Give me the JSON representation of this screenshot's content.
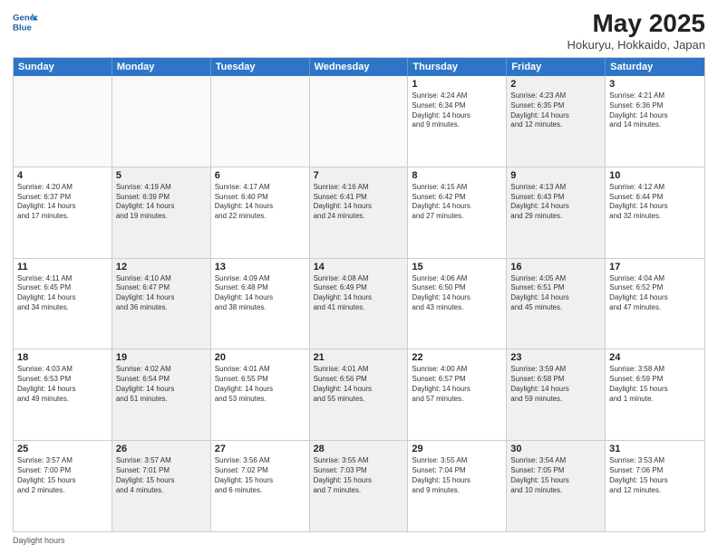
{
  "header": {
    "logo_line1": "General",
    "logo_line2": "Blue",
    "title": "May 2025",
    "subtitle": "Hokuryu, Hokkaido, Japan"
  },
  "days_of_week": [
    "Sunday",
    "Monday",
    "Tuesday",
    "Wednesday",
    "Thursday",
    "Friday",
    "Saturday"
  ],
  "weeks": [
    [
      {
        "day": "",
        "text": "",
        "shaded": true,
        "empty": true
      },
      {
        "day": "",
        "text": "",
        "shaded": true,
        "empty": true
      },
      {
        "day": "",
        "text": "",
        "shaded": true,
        "empty": true
      },
      {
        "day": "",
        "text": "",
        "shaded": true,
        "empty": true
      },
      {
        "day": "1",
        "text": "Sunrise: 4:24 AM\nSunset: 6:34 PM\nDaylight: 14 hours\nand 9 minutes.",
        "shaded": false
      },
      {
        "day": "2",
        "text": "Sunrise: 4:23 AM\nSunset: 6:35 PM\nDaylight: 14 hours\nand 12 minutes.",
        "shaded": true
      },
      {
        "day": "3",
        "text": "Sunrise: 4:21 AM\nSunset: 6:36 PM\nDaylight: 14 hours\nand 14 minutes.",
        "shaded": false
      }
    ],
    [
      {
        "day": "4",
        "text": "Sunrise: 4:20 AM\nSunset: 6:37 PM\nDaylight: 14 hours\nand 17 minutes.",
        "shaded": false
      },
      {
        "day": "5",
        "text": "Sunrise: 4:19 AM\nSunset: 6:39 PM\nDaylight: 14 hours\nand 19 minutes.",
        "shaded": true
      },
      {
        "day": "6",
        "text": "Sunrise: 4:17 AM\nSunset: 6:40 PM\nDaylight: 14 hours\nand 22 minutes.",
        "shaded": false
      },
      {
        "day": "7",
        "text": "Sunrise: 4:16 AM\nSunset: 6:41 PM\nDaylight: 14 hours\nand 24 minutes.",
        "shaded": true
      },
      {
        "day": "8",
        "text": "Sunrise: 4:15 AM\nSunset: 6:42 PM\nDaylight: 14 hours\nand 27 minutes.",
        "shaded": false
      },
      {
        "day": "9",
        "text": "Sunrise: 4:13 AM\nSunset: 6:43 PM\nDaylight: 14 hours\nand 29 minutes.",
        "shaded": true
      },
      {
        "day": "10",
        "text": "Sunrise: 4:12 AM\nSunset: 6:44 PM\nDaylight: 14 hours\nand 32 minutes.",
        "shaded": false
      }
    ],
    [
      {
        "day": "11",
        "text": "Sunrise: 4:11 AM\nSunset: 6:45 PM\nDaylight: 14 hours\nand 34 minutes.",
        "shaded": false
      },
      {
        "day": "12",
        "text": "Sunrise: 4:10 AM\nSunset: 6:47 PM\nDaylight: 14 hours\nand 36 minutes.",
        "shaded": true
      },
      {
        "day": "13",
        "text": "Sunrise: 4:09 AM\nSunset: 6:48 PM\nDaylight: 14 hours\nand 38 minutes.",
        "shaded": false
      },
      {
        "day": "14",
        "text": "Sunrise: 4:08 AM\nSunset: 6:49 PM\nDaylight: 14 hours\nand 41 minutes.",
        "shaded": true
      },
      {
        "day": "15",
        "text": "Sunrise: 4:06 AM\nSunset: 6:50 PM\nDaylight: 14 hours\nand 43 minutes.",
        "shaded": false
      },
      {
        "day": "16",
        "text": "Sunrise: 4:05 AM\nSunset: 6:51 PM\nDaylight: 14 hours\nand 45 minutes.",
        "shaded": true
      },
      {
        "day": "17",
        "text": "Sunrise: 4:04 AM\nSunset: 6:52 PM\nDaylight: 14 hours\nand 47 minutes.",
        "shaded": false
      }
    ],
    [
      {
        "day": "18",
        "text": "Sunrise: 4:03 AM\nSunset: 6:53 PM\nDaylight: 14 hours\nand 49 minutes.",
        "shaded": false
      },
      {
        "day": "19",
        "text": "Sunrise: 4:02 AM\nSunset: 6:54 PM\nDaylight: 14 hours\nand 51 minutes.",
        "shaded": true
      },
      {
        "day": "20",
        "text": "Sunrise: 4:01 AM\nSunset: 6:55 PM\nDaylight: 14 hours\nand 53 minutes.",
        "shaded": false
      },
      {
        "day": "21",
        "text": "Sunrise: 4:01 AM\nSunset: 6:56 PM\nDaylight: 14 hours\nand 55 minutes.",
        "shaded": true
      },
      {
        "day": "22",
        "text": "Sunrise: 4:00 AM\nSunset: 6:57 PM\nDaylight: 14 hours\nand 57 minutes.",
        "shaded": false
      },
      {
        "day": "23",
        "text": "Sunrise: 3:59 AM\nSunset: 6:58 PM\nDaylight: 14 hours\nand 59 minutes.",
        "shaded": true
      },
      {
        "day": "24",
        "text": "Sunrise: 3:58 AM\nSunset: 6:59 PM\nDaylight: 15 hours\nand 1 minute.",
        "shaded": false
      }
    ],
    [
      {
        "day": "25",
        "text": "Sunrise: 3:57 AM\nSunset: 7:00 PM\nDaylight: 15 hours\nand 2 minutes.",
        "shaded": false
      },
      {
        "day": "26",
        "text": "Sunrise: 3:57 AM\nSunset: 7:01 PM\nDaylight: 15 hours\nand 4 minutes.",
        "shaded": true
      },
      {
        "day": "27",
        "text": "Sunrise: 3:56 AM\nSunset: 7:02 PM\nDaylight: 15 hours\nand 6 minutes.",
        "shaded": false
      },
      {
        "day": "28",
        "text": "Sunrise: 3:55 AM\nSunset: 7:03 PM\nDaylight: 15 hours\nand 7 minutes.",
        "shaded": true
      },
      {
        "day": "29",
        "text": "Sunrise: 3:55 AM\nSunset: 7:04 PM\nDaylight: 15 hours\nand 9 minutes.",
        "shaded": false
      },
      {
        "day": "30",
        "text": "Sunrise: 3:54 AM\nSunset: 7:05 PM\nDaylight: 15 hours\nand 10 minutes.",
        "shaded": true
      },
      {
        "day": "31",
        "text": "Sunrise: 3:53 AM\nSunset: 7:06 PM\nDaylight: 15 hours\nand 12 minutes.",
        "shaded": false
      }
    ]
  ],
  "footer": "Daylight hours"
}
